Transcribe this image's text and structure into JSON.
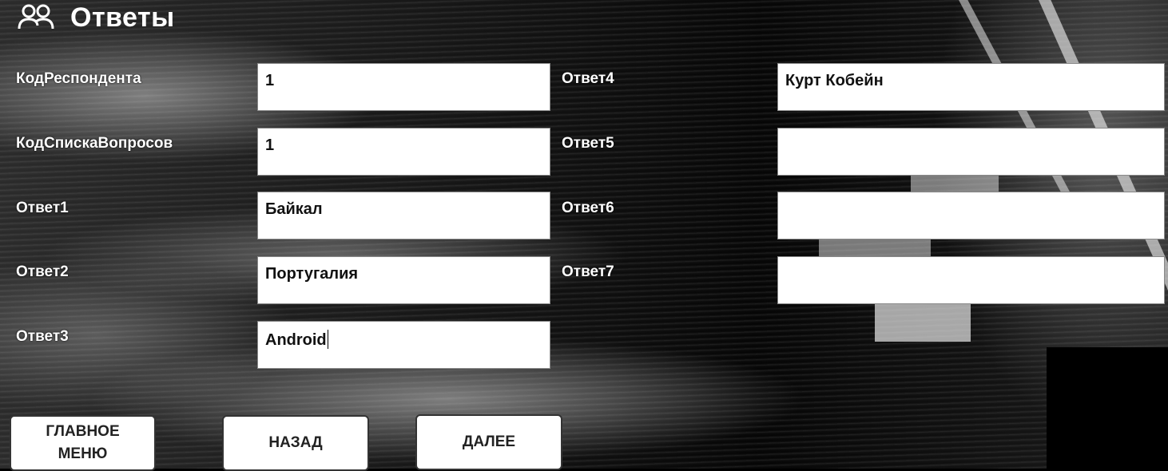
{
  "title": "Ответы",
  "fields": {
    "respondent_code": {
      "label": "КодРеспондента",
      "value": "1"
    },
    "question_list_code": {
      "label": "КодСпискаВопросов",
      "value": "1"
    },
    "answer1": {
      "label": "Ответ1",
      "value": "Байкал"
    },
    "answer2": {
      "label": "Ответ2",
      "value": "Португалия"
    },
    "answer3": {
      "label": "Ответ3",
      "value": "Android"
    },
    "answer4": {
      "label": "Ответ4",
      "value": "Курт Кобейн"
    },
    "answer5": {
      "label": "Ответ5",
      "value": ""
    },
    "answer6": {
      "label": "Ответ6",
      "value": ""
    },
    "answer7": {
      "label": "Ответ7",
      "value": ""
    }
  },
  "buttons": {
    "main_menu_line1": "ГЛАВНОЕ",
    "main_menu_line2": "МЕНЮ",
    "back": "НАЗАД",
    "next": "ДАЛЕЕ"
  },
  "icons": {
    "title_icon": "users-icon"
  }
}
